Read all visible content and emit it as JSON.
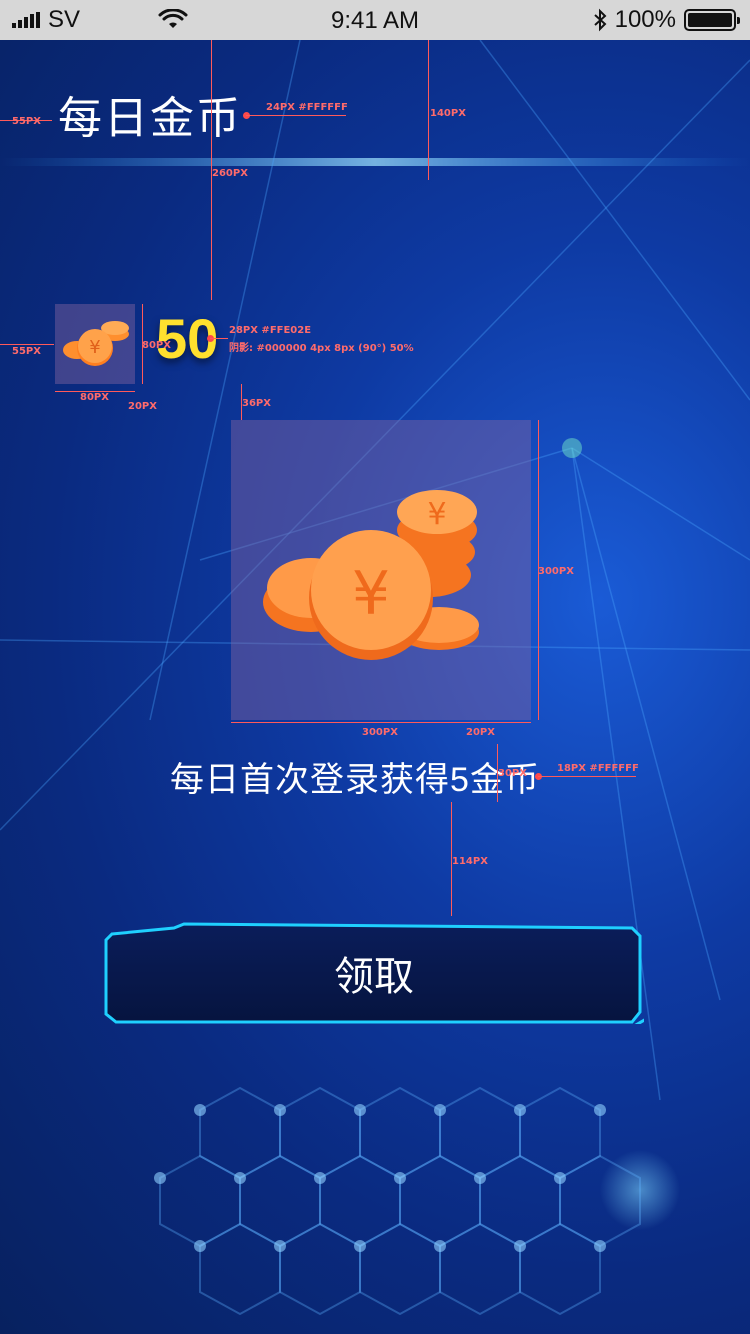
{
  "status_bar": {
    "carrier": "SV",
    "time": "9:41 AM",
    "battery": "100%"
  },
  "title": "每日金币",
  "coins": {
    "count": "50"
  },
  "reward": {
    "description": "每日首次登录获得5金币"
  },
  "claim_button": {
    "label": "领取"
  },
  "annotations": {
    "title_left": "55PX",
    "title_style": "24PX #FFFFFF",
    "title_top": "140PX",
    "coins_top": "260PX",
    "coin_left": "55PX",
    "coin_height": "80PX",
    "coin_width": "80PX",
    "coin_gap": "20PX",
    "count_style": "28PX #FFE02E",
    "count_shadow": "阴影: #000000 4px 8px (90°) 50%",
    "image_gap": "36PX",
    "image_height": "300PX",
    "image_width": "300PX",
    "image_bottom_gap": "20PX",
    "desc_height": "30PX",
    "desc_style": "18PX #FFFFFF",
    "button_gap": "114PX"
  },
  "colors": {
    "accent": "#FFE02E",
    "text": "#FFFFFF",
    "button_border": "#1fd0ff"
  }
}
